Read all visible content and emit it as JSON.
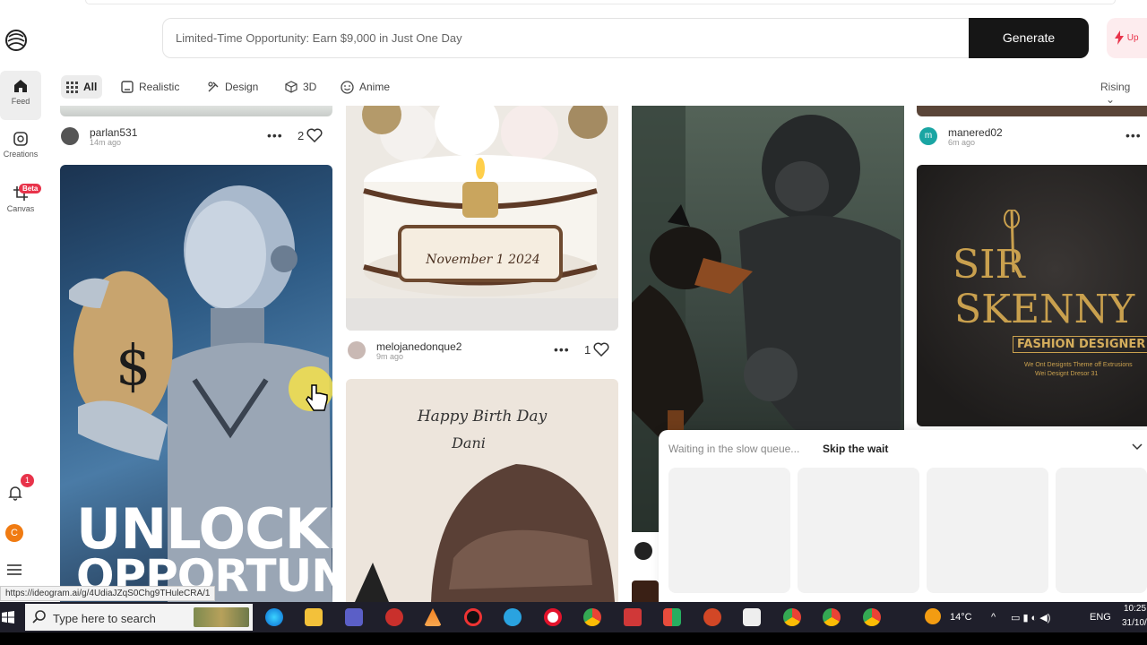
{
  "prompt": {
    "text": "Limited-Time Opportunity: Earn $9,000 in Just One Day",
    "generate_label": "Generate",
    "upgrade_label": "Up"
  },
  "sidebar": {
    "items": [
      {
        "label": "Feed",
        "icon": "home-icon",
        "active": true
      },
      {
        "label": "Creations",
        "icon": "creations-icon",
        "active": false
      },
      {
        "label": "Canvas",
        "icon": "canvas-icon",
        "active": false,
        "badge": "Beta"
      }
    ],
    "notification_count": "1",
    "user_initial": "C"
  },
  "tabs": [
    {
      "label": "All",
      "icon": "grid-icon",
      "active": true
    },
    {
      "label": "Realistic",
      "icon": "camera-icon"
    },
    {
      "label": "Design",
      "icon": "palette-icon"
    },
    {
      "label": "3D",
      "icon": "cube-icon"
    },
    {
      "label": "Anime",
      "icon": "smile-icon"
    }
  ],
  "sort_label": "Rising",
  "cards": {
    "c1_meta": {
      "user": "parlan531",
      "time": "14m ago",
      "likes": "2"
    },
    "c1_image_text": [
      "UNLOCKING",
      "OPPORTUNITIES"
    ],
    "c2_image_text": "November 1 2024",
    "c2_meta": {
      "user": "melojanedonque2",
      "time": "9m ago",
      "likes": "1"
    },
    "c3_image_text": [
      "Happy Birth Day",
      "Dani"
    ],
    "c4_meta": {
      "user": "manered02",
      "time": "6m ago",
      "avatar_initial": "m"
    },
    "c4_image_text": [
      "SIR",
      "SKENNY",
      "FASHION DESIGNER",
      "We Ont Designts Theme off Extrusions",
      "Wei Designt Dresor 31"
    ]
  },
  "queue": {
    "status": "Waiting in the slow queue...",
    "skip_label": "Skip the wait"
  },
  "status_url": "https://ideogram.ai/g/4UdiaJZqS0Chg9THuleCRA/1",
  "taskbar": {
    "search_placeholder": "Type here to search",
    "temperature": "14°C",
    "language": "ENG",
    "time": "10:25",
    "date": "31/10/"
  }
}
